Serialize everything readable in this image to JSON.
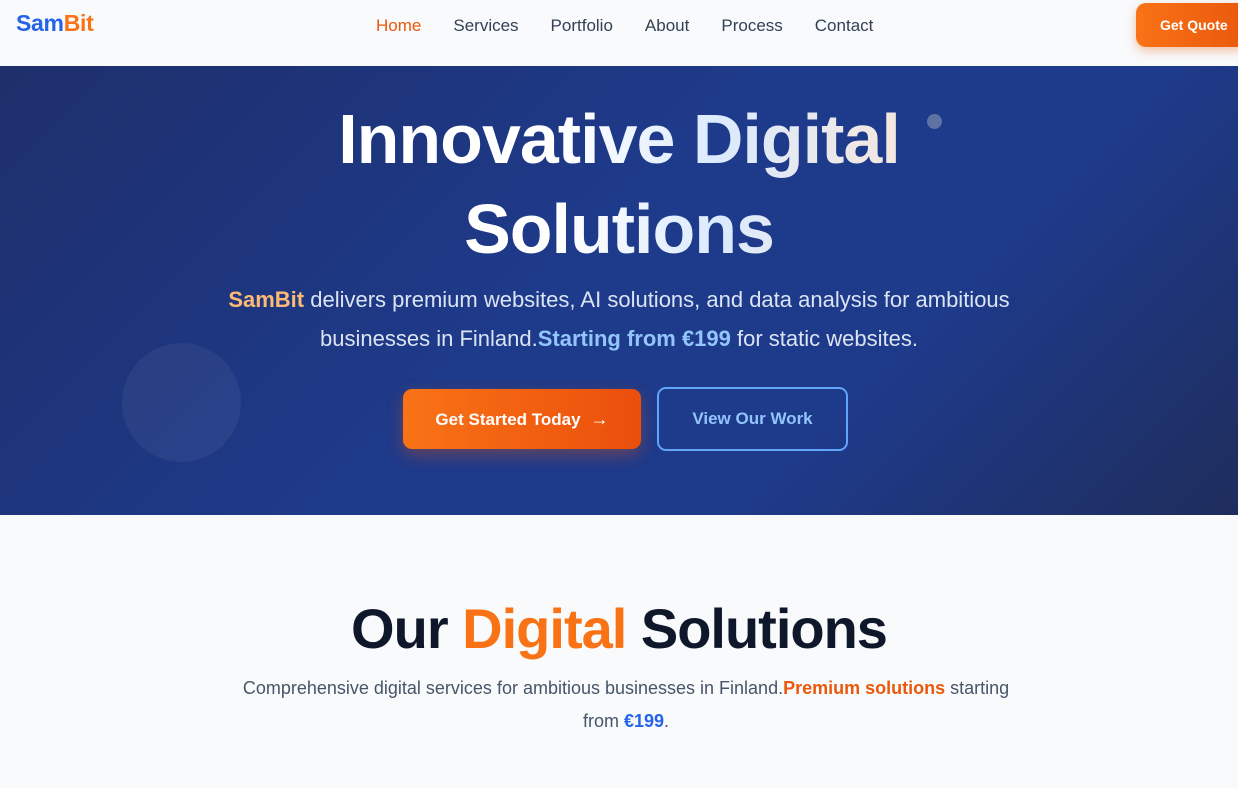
{
  "header": {
    "logo_part1": "Sam",
    "logo_part2": "Bit",
    "nav": [
      "Home",
      "Services",
      "Portfolio",
      "About",
      "Process",
      "Contact"
    ],
    "active_nav": "Home",
    "cta_label": "Get Quote"
  },
  "hero": {
    "title_line1": "Innovative Digital",
    "title_line2": "Solutions",
    "sub_brand": "SamBit",
    "sub_text1": " delivers premium websites, AI solutions, and data analysis for ambitious businesses in Finland.",
    "sub_price": "Starting from €199",
    "sub_text2": " for static websites.",
    "primary_button": "Get Started Today",
    "primary_button_arrow": "→",
    "secondary_button": "View Our Work"
  },
  "solutions": {
    "title_part1": "Our ",
    "title_accent": "Digital",
    "title_part2": " Solutions",
    "sub_text1": "Comprehensive digital services for ambitious businesses in Finland.",
    "sub_highlight": "Premium solutions",
    "sub_text2": " starting from ",
    "sub_price": "€199",
    "sub_text3": "."
  },
  "colors": {
    "accent_orange": "#f97316",
    "brand_blue": "#2563eb",
    "hero_bg": "#1e3a8a"
  }
}
